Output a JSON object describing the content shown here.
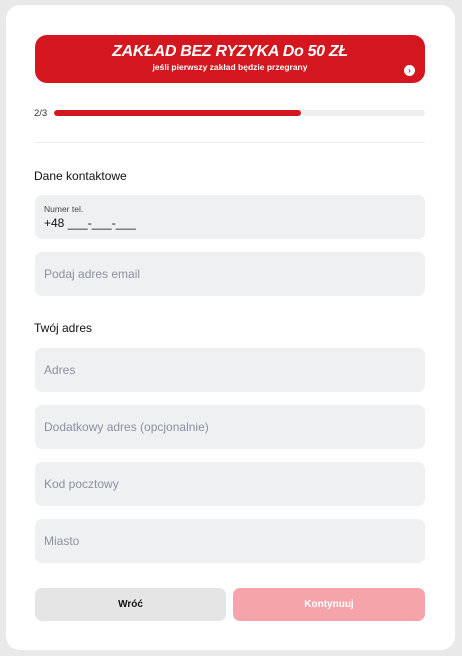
{
  "banner": {
    "title": "ZAKŁAD BEZ RYZYKA Do 50 ZŁ",
    "subtitle": "jeśli pierwszy zakład będzie przegrany",
    "arrow_icon": "chevron-right-icon",
    "color": "#d4161f"
  },
  "progress": {
    "label": "2/3",
    "fraction": 0.667
  },
  "contact": {
    "title": "Dane kontaktowe",
    "phone_label": "Numer tel.",
    "phone_value": "+48 ___-___-___",
    "email_placeholder": "Podaj adres email"
  },
  "address": {
    "title": "Twój adres",
    "address_placeholder": "Adres",
    "address2_placeholder": "Dodatkowy adres (opcjonalnie)",
    "postal_placeholder": "Kod pocztowy",
    "city_placeholder": "Miasto"
  },
  "buttons": {
    "back_label": "Wróć",
    "continue_label": "Kontynuuj"
  }
}
